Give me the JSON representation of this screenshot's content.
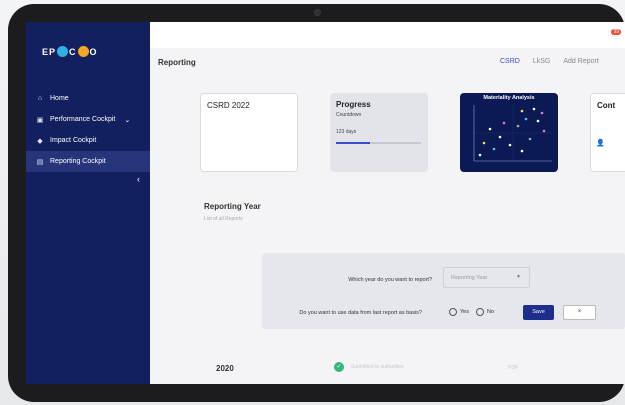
{
  "app": {
    "logo_text": "EPACTO"
  },
  "sidebar": {
    "items": [
      {
        "label": "Home",
        "icon": "home-icon",
        "active": false
      },
      {
        "label": "Performance Cockpit",
        "icon": "chart-icon",
        "active": false,
        "has_chevron": true
      },
      {
        "label": "Impact Cockpit",
        "icon": "diamond-icon",
        "active": false
      },
      {
        "label": "Reporting Cockpit",
        "icon": "document-icon",
        "active": true
      }
    ],
    "collapse_glyph": "‹"
  },
  "topbar": {
    "notification_badge": "99"
  },
  "main": {
    "title": "Reporting",
    "tabs": [
      {
        "label": "CSRD",
        "active": true
      },
      {
        "label": "LkSG",
        "active": false
      },
      {
        "label": "Add Report",
        "active": false
      }
    ],
    "cards": {
      "csrd": {
        "title": "CSRD 2022"
      },
      "progress": {
        "title": "Progress",
        "subtitle": "Countdown",
        "days": "123 days",
        "fraction": 0.4
      },
      "matrix": {
        "title": "Materiality Analysis"
      },
      "cont": {
        "title": "Cont"
      }
    },
    "section": {
      "title": "Reporting Year",
      "subtitle": "List of all Reports"
    },
    "form": {
      "question_year": "Which year do you want to report?",
      "year_placeholder": "Reporting Year",
      "question_basis": "Do you want to use data from last report as basis?",
      "option_yes": "Yes",
      "option_no": "No",
      "save_label": "Save",
      "close_label": "×"
    },
    "rows": [
      {
        "year": "2020",
        "status": "Submitted to authorities",
        "format": "PDF"
      }
    ]
  },
  "colors": {
    "sidebar": "#12205f",
    "accent": "#3a4bd0",
    "save": "#1d2e8c",
    "success": "#36b37e"
  }
}
